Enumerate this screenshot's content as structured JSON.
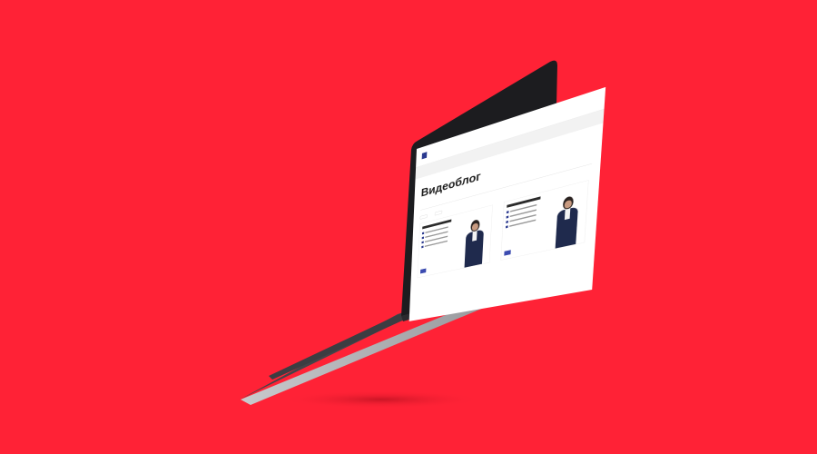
{
  "colors": {
    "background": "#ff2236",
    "accent": "#ff2236",
    "brand": "#2b3a8f"
  },
  "header": {
    "logo_icon": "bank-logo-icon",
    "nav": [
      "",
      "",
      "",
      "",
      ""
    ],
    "right_links": [
      "",
      ""
    ]
  },
  "breadcrumb": "",
  "page_title": "Видеоблог",
  "tabs": [
    "",
    "",
    "",
    ""
  ],
  "filters": [
    "",
    ""
  ],
  "cards": [
    {
      "date": "",
      "title": ""
    },
    {
      "date": "",
      "title": ""
    }
  ]
}
